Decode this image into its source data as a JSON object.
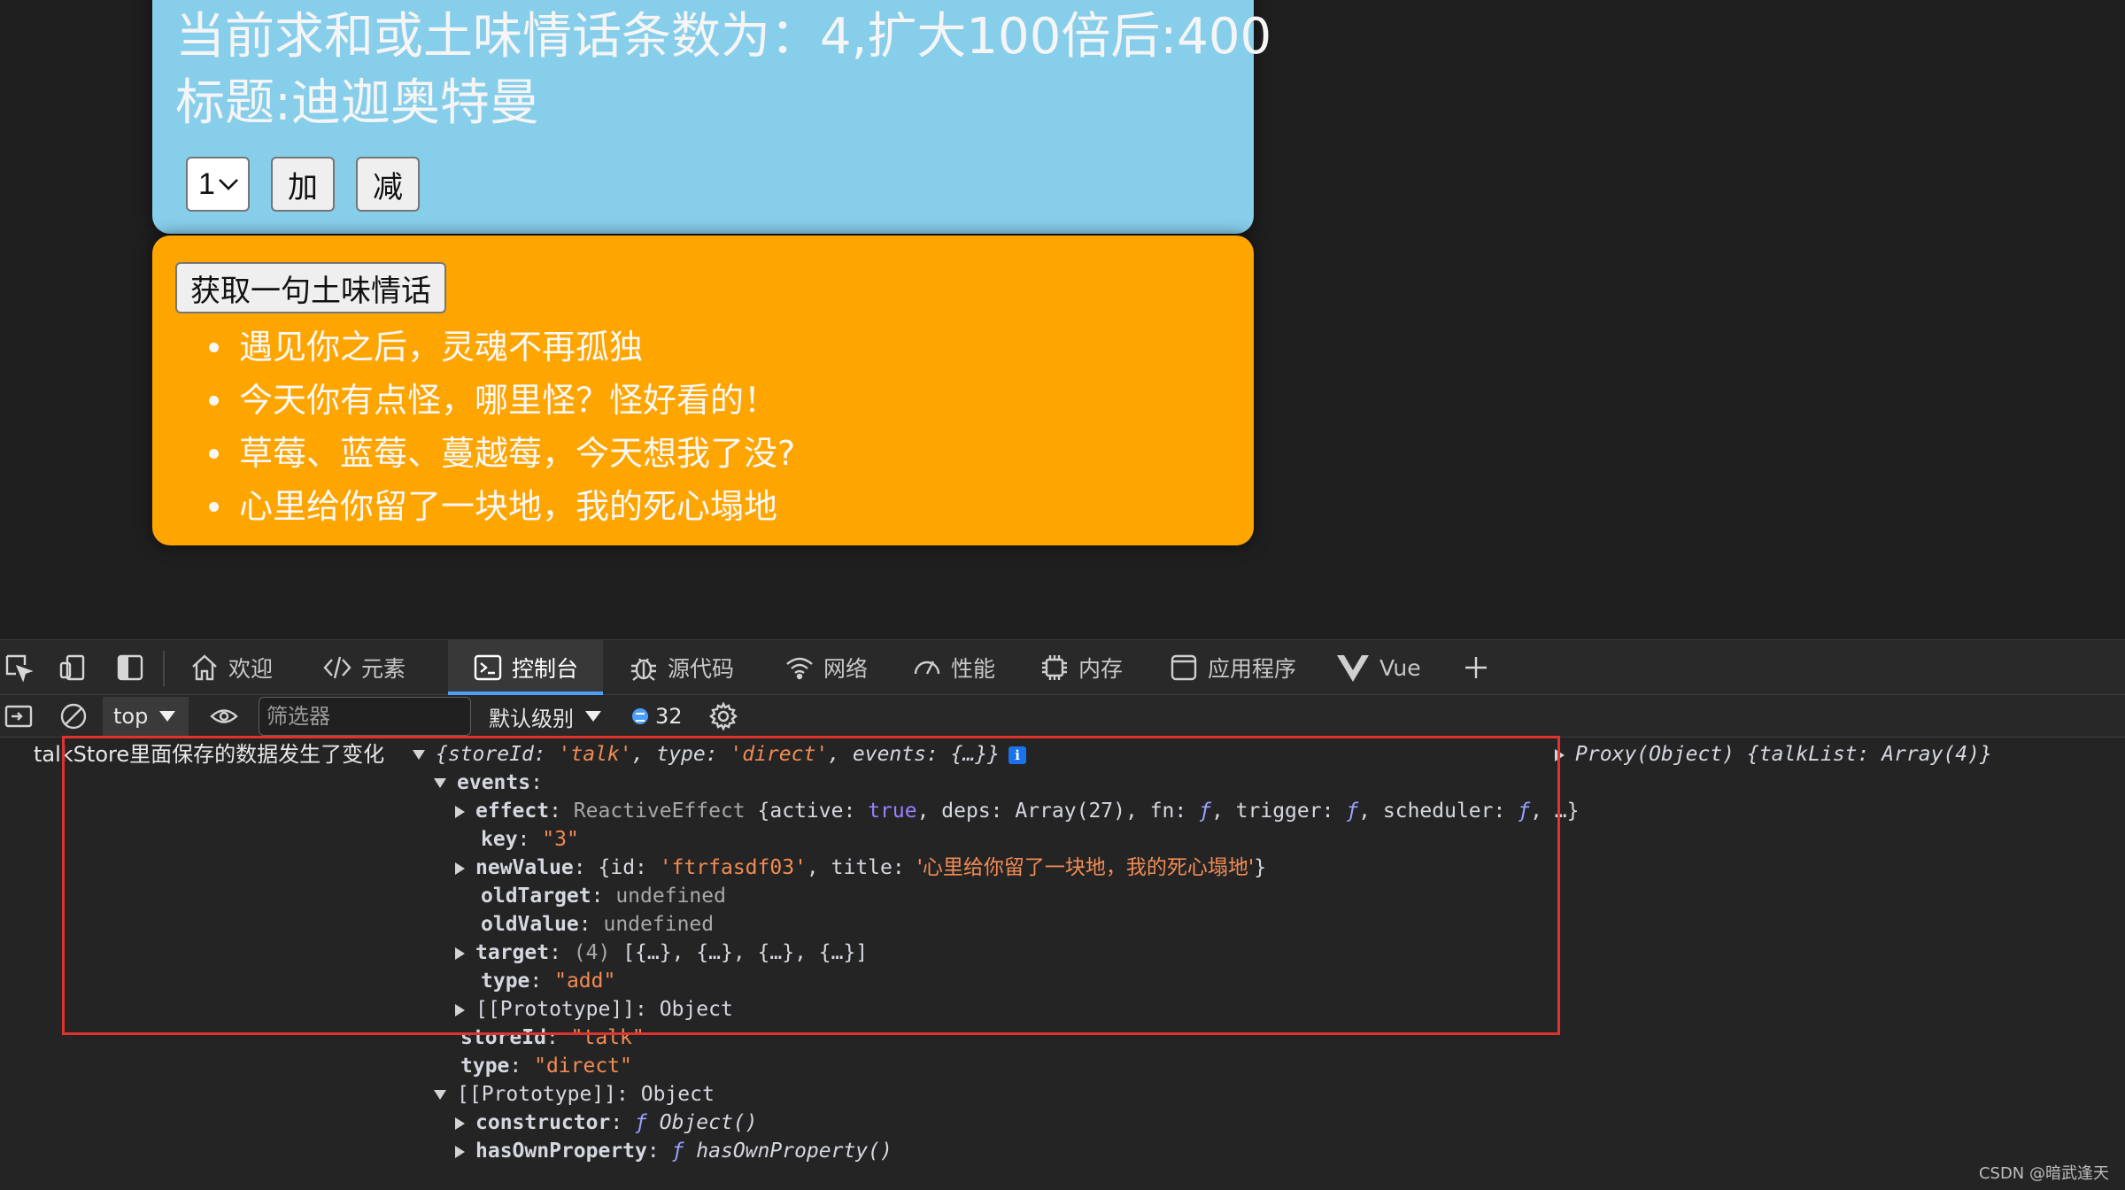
{
  "page": {
    "sum_card": {
      "sum_line": "当前求和或土味情话条数为：4,扩大100倍后:400",
      "title_line": "标题:迪迦奥特曼",
      "select_value": "1",
      "add_button": "加",
      "minus_button": "减",
      "bg_color": "#87ceeb"
    },
    "talk_card": {
      "fetch_button": "获取一句土味情话",
      "items": [
        "遇见你之后，灵魂不再孤独",
        "今天你有点怪，哪里怪？怪好看的！",
        "草莓、蓝莓、蔓越莓，今天想我了没?",
        "心里给你留了一块地，我的死心塌地"
      ],
      "bg_color": "#ffa500"
    }
  },
  "devtools": {
    "tabs": [
      {
        "label": "欢迎",
        "icon": "home-icon"
      },
      {
        "label": "元素",
        "icon": "code-icon"
      },
      {
        "label": "控制台",
        "icon": "console-icon",
        "active": true
      },
      {
        "label": "源代码",
        "icon": "bug-icon"
      },
      {
        "label": "网络",
        "icon": "wifi-icon"
      },
      {
        "label": "性能",
        "icon": "gauge-icon"
      },
      {
        "label": "内存",
        "icon": "chip-icon"
      },
      {
        "label": "应用程序",
        "icon": "app-icon"
      },
      {
        "label": "Vue",
        "icon": "vue-icon"
      }
    ],
    "toolbar": {
      "context": "top",
      "filter_placeholder": "筛选器",
      "level": "默认级别",
      "message_count": "32"
    },
    "console": {
      "log_message": "talkStore里面保存的数据发生了变化",
      "summary": {
        "open": "{",
        "storeId_key": "storeId",
        "storeId_val": "'talk'",
        "type_key": "type",
        "type_val": "'direct'",
        "events_key": "events",
        "events_val": "{…}",
        "close": "}",
        "info": "i"
      },
      "right_value": {
        "prefix": "Proxy(Object)",
        "open": "{",
        "key": "talkList",
        "val": "Array(4)",
        "close": "}"
      },
      "events_label": "events",
      "effect": {
        "key": "effect",
        "class_name": "ReactiveEffect",
        "open": "{",
        "active_key": "active",
        "active_val": "true",
        "deps_key": "deps",
        "deps_val": "Array(27)",
        "fn_key": "fn",
        "fn_val": "ƒ",
        "trigger_key": "trigger",
        "trigger_val": "ƒ",
        "scheduler_key": "scheduler",
        "scheduler_val": "ƒ",
        "rest": "…}"
      },
      "key_line": {
        "key": "key",
        "val": "\"3\""
      },
      "new_value": {
        "key": "newValue",
        "open": "{",
        "id_key": "id",
        "id_val": "'ftrfasdf03'",
        "title_key": "title",
        "title_val": "'心里给你留了一块地，我的死心塌地'",
        "close": "}"
      },
      "old_target": {
        "key": "oldTarget",
        "val": "undefined"
      },
      "old_value": {
        "key": "oldValue",
        "val": "undefined"
      },
      "target": {
        "key": "target",
        "count": "(4)",
        "val": "[{…}, {…}, {…}, {…}]"
      },
      "type_line": {
        "key": "type",
        "val": "\"add\""
      },
      "events_proto": {
        "key": "[[Prototype]]",
        "val": "Object"
      },
      "store_id": {
        "key": "storeId",
        "val": "\"talk\""
      },
      "type_direct": {
        "key": "type",
        "val": "\"direct\""
      },
      "root_proto": {
        "key": "[[Prototype]]",
        "val": "Object"
      },
      "constructor_line": {
        "key": "constructor",
        "f": "ƒ",
        "val": "Object()"
      },
      "hasown_line": {
        "key": "hasOwnProperty",
        "f": "ƒ",
        "val": "hasOwnProperty()"
      }
    },
    "highlight_color": "#e0322f"
  },
  "watermark": "CSDN @暗武逢天"
}
